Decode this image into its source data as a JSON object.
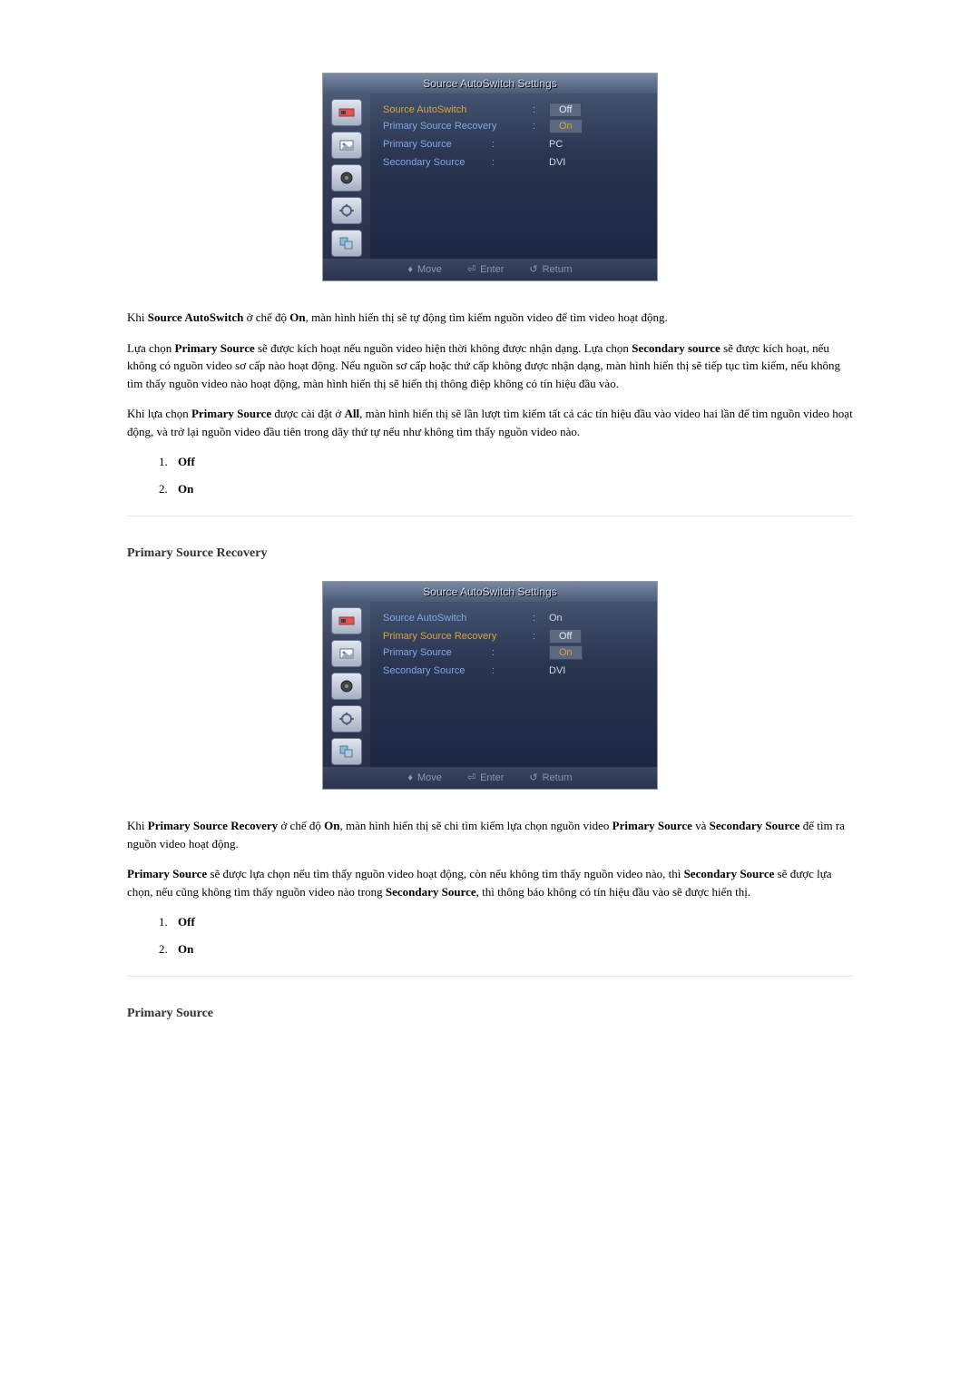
{
  "osd1": {
    "title": "Source AutoSwitch Settings",
    "rows": {
      "r1": {
        "label": "Source AutoSwitch",
        "value_off": "Off",
        "value_on": "On"
      },
      "r2": {
        "label": "Primary Source Recovery",
        "value": "On"
      },
      "r3": {
        "label": "Primary Source",
        "value": "PC"
      },
      "r4": {
        "label": "Secondary Source",
        "value": "DVI"
      }
    },
    "footer": {
      "move": "Move",
      "enter": "Enter",
      "return": "Return"
    }
  },
  "osd2": {
    "title": "Source AutoSwitch Settings",
    "rows": {
      "r1": {
        "label": "Source AutoSwitch",
        "value": "On"
      },
      "r2": {
        "label": "Primary Source Recovery",
        "value_off": "Off",
        "value_on": "On"
      },
      "r3": {
        "label": "Primary Source",
        "value": ""
      },
      "r4": {
        "label": "Secondary Source",
        "value": "DVI"
      }
    },
    "footer": {
      "move": "Move",
      "enter": "Enter",
      "return": "Return"
    }
  },
  "para1": {
    "t1": "Khi ",
    "b1": "Source AutoSwitch",
    "t2": " ở chế độ ",
    "b2": "On",
    "t3": ", màn hình hiển thị sẽ tự động tìm kiếm nguồn video để tìm video hoạt động."
  },
  "para2": {
    "t1": "Lựa chọn ",
    "b1": "Primary Source",
    "t2": " sẽ được kích hoạt nếu nguồn video hiện thời không được nhận dạng. Lựa chọn ",
    "b2": "Secondary source",
    "t3": " sẽ được kích hoạt, nếu không có nguồn video sơ cấp nào hoạt động. Nếu nguồn sơ cấp hoặc thứ cấp không được nhận dạng, màn hình hiển thị sẽ tiếp tục tìm kiếm, nếu không tìm thấy nguồn video nào hoạt động, màn hình hiển thị sẽ hiển thị thông điệp không có tín hiệu đầu vào."
  },
  "para3": {
    "t1": "Khi lựa chọn ",
    "b1": "Primary Source",
    "t2": " được cài đặt ở ",
    "b2": "All",
    "t3": ", màn hình hiển thị sẽ lần lượt tìm kiếm tất cả các tín hiệu đầu vào video hai lần để tìm nguồn video hoạt động, và trở lại nguồn video đầu tiên trong dãy thứ tự nếu như không tìm thấy nguồn video nào."
  },
  "opts_a": {
    "off": "Off",
    "on": "On"
  },
  "heading_psr": "Primary Source Recovery",
  "para4": {
    "t1": "Khi ",
    "b1": "Primary Source Recovery",
    "t2": " ở chế độ ",
    "b2": "On",
    "t3": ", màn hình hiển thị sẽ chi tìm kiếm lựa chọn nguồn video ",
    "b3": "Primary Source",
    "t4": " và ",
    "b4": "Secondary Source",
    "t5": " để tìm ra nguồn video hoạt động."
  },
  "para5": {
    "b1": "Primary Source",
    "t1": " sẽ được lựa chọn nếu tìm thấy nguồn video hoạt động, còn nếu không tìm thấy nguồn video nào, thì ",
    "b2": "Secondary Source",
    "t2": " sẽ được lựa chọn, nếu cũng không tìm thấy nguồn video nào trong ",
    "b3": "Secondary Source",
    "t3": ", thì thông báo không có tín hiệu đầu vào sẽ được hiển thị."
  },
  "opts_b": {
    "off": "Off",
    "on": "On"
  },
  "heading_ps": "Primary Source"
}
